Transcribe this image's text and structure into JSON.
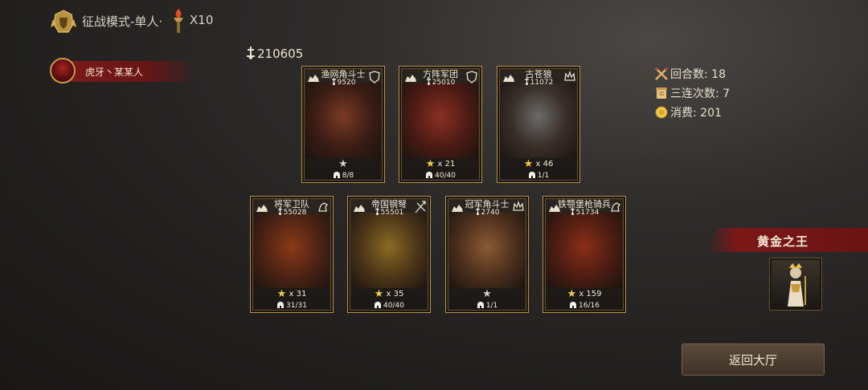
{
  "header": {
    "emblem_icon": "golden-helmet-icon",
    "mode_title": "征战模式-单人·",
    "torch_icon": "torch-icon",
    "ticket_count": "X10"
  },
  "player": {
    "name": "虎牙丶某某人",
    "avatar_icon": "red-demon-avatar"
  },
  "power": {
    "icon": "power-icon",
    "value": "210605"
  },
  "stats": {
    "rounds": "回合数: 18",
    "combo": "三连次数: 7",
    "cost": "消费: 201"
  },
  "cards": [
    {
      "name": "渔网角斗士",
      "power": "9520",
      "stars": "",
      "star_gray": true,
      "troops": "8/8",
      "color": "#5a2a1c"
    },
    {
      "name": "方阵军团",
      "power": "25010",
      "stars": "x 21",
      "star_gray": false,
      "troops": "40/40",
      "color": "#6a2a1e"
    },
    {
      "name": "古苍狼",
      "power": "11072",
      "stars": "x 46",
      "star_gray": false,
      "troops": "1/1",
      "color": "#3a3a3a"
    },
    {
      "name": "将军卫队",
      "power": "55028",
      "stars": "x 31",
      "star_gray": false,
      "troops": "31/31",
      "color": "#6a3016"
    },
    {
      "name": "帝国钢弩",
      "power": "55501",
      "stars": "x 35",
      "star_gray": false,
      "troops": "40/40",
      "color": "#5a4018"
    },
    {
      "name": "冠军角斗士",
      "power": "2740",
      "stars": "",
      "star_gray": true,
      "troops": "1/1",
      "color": "#5a3a22"
    },
    {
      "name": "铁颚堡枪骑兵",
      "power": "51734",
      "stars": "x 159",
      "star_gray": false,
      "troops": "16/16",
      "color": "#6a2416"
    }
  ],
  "king": {
    "title": "黄金之王",
    "portrait_icon": "golden-king-portrait"
  },
  "back_button": {
    "label": "返回大厅"
  }
}
